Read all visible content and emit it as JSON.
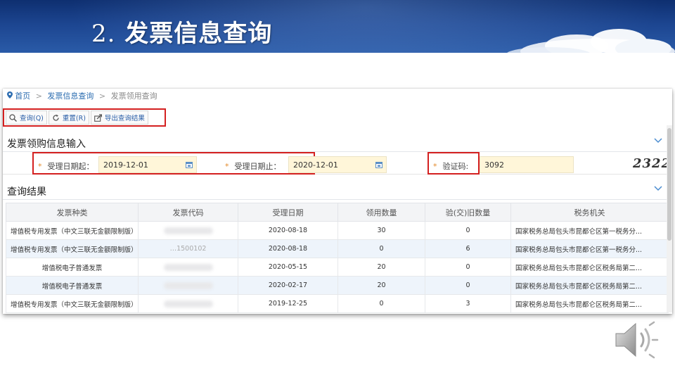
{
  "slide": {
    "title_number": "2.",
    "title_text": "发票信息查询"
  },
  "breadcrumb": {
    "home": "首页",
    "sep1": ">",
    "level2": "发票信息查询",
    "sep2": ">",
    "current": "发票领用查询"
  },
  "toolbar": {
    "query_label": "查询(Q)",
    "reset_label": "重置(R)",
    "export_label": "导出查询结果"
  },
  "input_section": {
    "title": "发票领购信息输入",
    "date_start_label": "受理日期起：",
    "date_start_value": "2019-12-01",
    "date_end_label": "受理日期止：",
    "date_end_value": "2020-12-01",
    "captcha_label": "验证码:",
    "captcha_value": "3092",
    "captcha_image_text": "2322",
    "required_mark": "*"
  },
  "result_section": {
    "title": "查询结果",
    "columns": [
      "发票种类",
      "发票代码",
      "受理日期",
      "领用数量",
      "验(交)旧数量",
      "税务机关"
    ],
    "rows": [
      {
        "type": "增值税专用发票（中文三联无金额限制版）",
        "code": "",
        "date": "2020-08-18",
        "qty": "30",
        "returned": "0",
        "authority": "国家税务总局包头市昆都仑区第一税务分..."
      },
      {
        "type": "增值税专用发票（中文三联无金额限制版）",
        "code": "…1500102",
        "date": "2020-08-18",
        "qty": "0",
        "returned": "6",
        "authority": "国家税务总局包头市昆都仑区第一税务分..."
      },
      {
        "type": "增值税电子普通发票",
        "code": "",
        "date": "2020-05-15",
        "qty": "20",
        "returned": "0",
        "authority": "国家税务总局包头市昆都仑区税务局第二..."
      },
      {
        "type": "增值税电子普通发票",
        "code": "",
        "date": "2020-02-17",
        "qty": "20",
        "returned": "0",
        "authority": "国家税务总局包头市昆都仑区税务局第二..."
      },
      {
        "type": "增值税专用发票（中文三联无金额限制版）",
        "code": "",
        "date": "2019-12-25",
        "qty": "0",
        "returned": "3",
        "authority": "国家税务总局包头市昆都仑区税务局第二..."
      }
    ]
  },
  "colors": {
    "banner": "#1c4590",
    "highlight_border": "#d42020",
    "link": "#2b6cb0",
    "input_bg": "#fff6d9",
    "alt_row": "#eef4fb"
  },
  "icons": {
    "location": "location-pin-icon",
    "search": "search-icon",
    "reset": "refresh-icon",
    "export": "export-icon",
    "calendar": "calendar-icon",
    "collapse": "chevron-down-icon",
    "audio": "speaker-icon"
  }
}
